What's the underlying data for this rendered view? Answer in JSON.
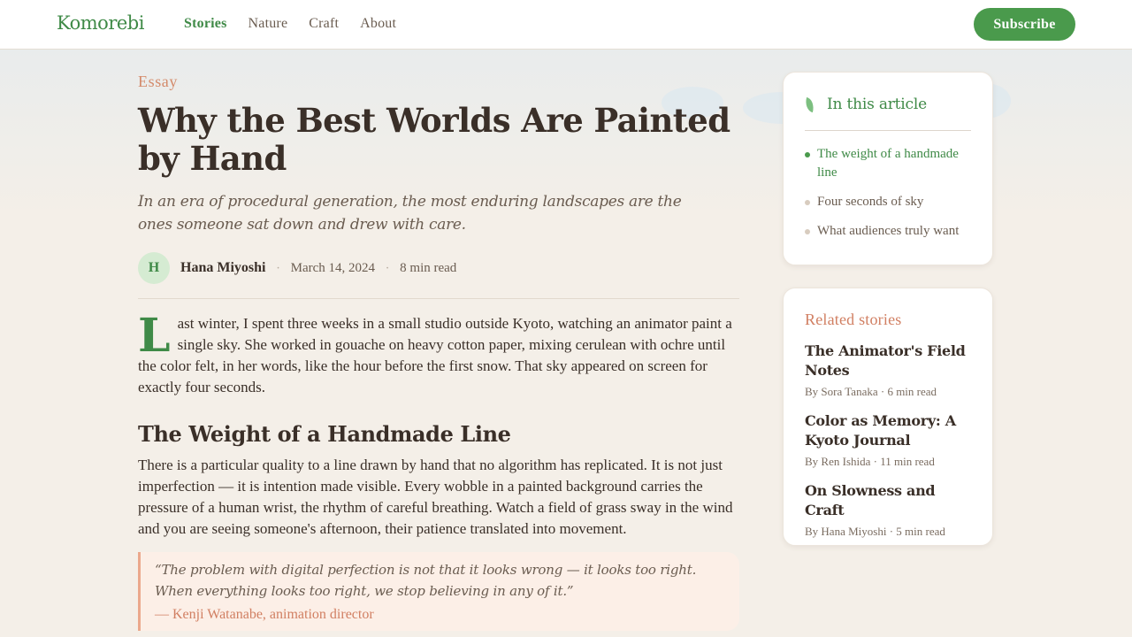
{
  "brand": {
    "logo": "Komorebi",
    "accent": "#3f8a47",
    "warm_accent": "#d17f62"
  },
  "nav": {
    "items": [
      {
        "label": "Stories",
        "active": true
      },
      {
        "label": "Nature",
        "active": false
      },
      {
        "label": "Craft",
        "active": false
      },
      {
        "label": "About",
        "active": false
      }
    ],
    "subscribe_label": "Subscribe"
  },
  "article": {
    "kicker": "Essay",
    "title": "Why the Best Worlds Are Painted by Hand",
    "dek": "In an era of procedural generation, the most enduring landscapes are the ones someone sat down and drew with care.",
    "author": {
      "initial": "H",
      "name": "Hana Miyoshi"
    },
    "date": "March 14, 2024",
    "read_time": "8 min read",
    "separator": "·",
    "lead": {
      "dropcap": "L",
      "text": "ast winter, I spent three weeks in a small studio outside Kyoto, watching an animator paint a single sky. She worked in gouache on heavy cotton paper, mixing cerulean with ochre until the color felt, in her words, like the hour before the first snow. That sky appeared on screen for exactly four seconds."
    },
    "section_heading": "The Weight of a Handmade Line",
    "paragraph2": "There is a particular quality to a line drawn by hand that no algorithm has replicated. It is not just imperfection — it is intention made visible. Every wobble in a painted background carries the pressure of a human wrist, the rhythm of careful breathing. Watch a field of grass sway in the wind and you are seeing someone's afternoon, their patience translated into movement.",
    "quote": {
      "text": "“The problem with digital perfection is not that it looks wrong — it looks too right. When everything looks too right, we stop believing in any of it.”",
      "cite": "— Kenji Watanabe, animation director"
    }
  },
  "toc": {
    "icon": "leaf-icon",
    "title": "In this article",
    "items": [
      {
        "label": "The weight of a handmade line",
        "active": true
      },
      {
        "label": "Four seconds of sky",
        "active": false
      },
      {
        "label": "What audiences truly want",
        "active": false
      }
    ]
  },
  "related": {
    "title": "Related stories",
    "stories": [
      {
        "title": "The Animator's Field Notes",
        "meta": "By Sora Tanaka · 6 min read"
      },
      {
        "title": "Color as Memory: A Kyoto Journal",
        "meta": "By Ren Ishida · 11 min read"
      },
      {
        "title": "On Slowness and Craft",
        "meta": "By Hana Miyoshi · 5 min read"
      }
    ]
  }
}
